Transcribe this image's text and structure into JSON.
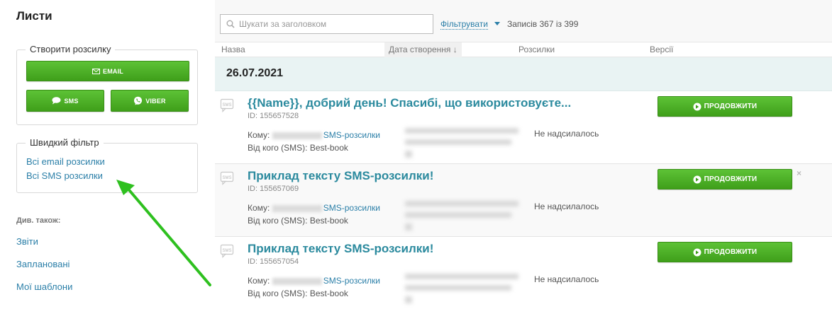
{
  "sidebar": {
    "title": "Листи",
    "create_legend": "Створити розсилку",
    "email_label": "EMAIL",
    "sms_label": "SMS",
    "viber_label": "VIBER",
    "filter_legend": "Швидкий фільтр",
    "filter_links": [
      "Всі email розсилки",
      "Всі SMS розсилки"
    ],
    "see_also": "Див. також:",
    "links": [
      "Звіти",
      "Заплановані",
      "Мої шаблони"
    ]
  },
  "toolbar": {
    "search_placeholder": "Шукати за заголовком",
    "filter_label": "Фільтрувати",
    "records_text": "Записів 367 із 399"
  },
  "table": {
    "headers": {
      "name": "Назва",
      "date": "Дата створення ↓",
      "mailings": "Розсилки",
      "versions": "Версії"
    },
    "group_date": "26.07.2021",
    "rows": [
      {
        "title": "{{Name}}, добрий день! Спасибі, що використовуєте...",
        "id": "ID: 155657528",
        "to_prefix": "Кому:",
        "to_link": "SMS-розсилки",
        "from": "Від кого (SMS): Best-book",
        "status": "Не надсилалось",
        "button": "ПРОДОВЖИТИ"
      },
      {
        "title": "Приклад тексту SMS-розсилки!",
        "id": "ID: 155657069",
        "to_prefix": "Кому:",
        "to_link": "SMS-розсилки",
        "from": "Від кого (SMS): Best-book",
        "status": "Не надсилалось",
        "button": "ПРОДОВЖИТИ",
        "close": "×"
      },
      {
        "title": "Приклад тексту SMS-розсилки!",
        "id": "ID: 155657054",
        "to_prefix": "Кому:",
        "to_link": "SMS-розсилки",
        "from": "Від кого (SMS): Best-book",
        "status": "Не надсилалось",
        "button": "ПРОДОВЖИТИ"
      }
    ]
  },
  "colors": {
    "accent_green": "#4caf25",
    "link_blue": "#2b7fa8",
    "title_teal": "#2b8a9e",
    "group_bg": "#e9f3f3"
  },
  "icons": [
    "envelope-icon",
    "chat-bubble-icon",
    "viber-icon",
    "search-icon",
    "sms-icon",
    "arrow-circle-right-icon",
    "close-icon",
    "annotation-arrow"
  ]
}
